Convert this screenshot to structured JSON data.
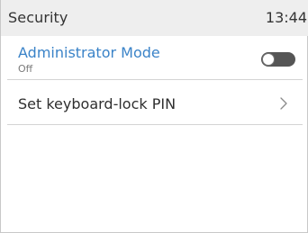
{
  "header": {
    "title": "Security",
    "time": "13:44"
  },
  "settings": {
    "admin_mode": {
      "label": "Administrator Mode",
      "value": "Off",
      "enabled": false
    },
    "keyboard_lock": {
      "label": "Set keyboard-lock PIN",
      "icon": "chevron-right-icon"
    }
  },
  "colors": {
    "accent": "#3a83c8",
    "header_bg": "#eeeeee",
    "toggle_off": "#555555"
  }
}
